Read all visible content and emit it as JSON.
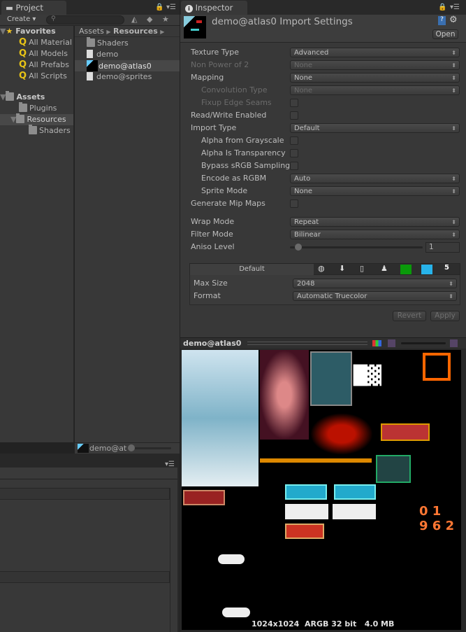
{
  "project": {
    "tab": "Project",
    "create": "Create",
    "search_placeholder": "",
    "favorites": {
      "title": "Favorites",
      "items": [
        "All Material",
        "All Models",
        "All Prefabs",
        "All Scripts"
      ]
    },
    "assets": {
      "title": "Assets",
      "items": [
        "Plugins",
        "Resources",
        "Shaders"
      ]
    },
    "breadcrumb": [
      "Assets",
      "Resources"
    ],
    "files": [
      "Shaders",
      "demo",
      "demo@atlas0",
      "demo@sprites"
    ],
    "footer_selected": "demo@at",
    "footer_zoom": 0.0
  },
  "inspector": {
    "tab": "Inspector",
    "title": "demo@atlas0 Import Settings",
    "open": "Open",
    "rows": [
      {
        "label": "Texture Type",
        "value": "Advanced"
      },
      {
        "label": "Non Power of 2",
        "value": "None"
      },
      {
        "label": "Mapping",
        "value": "None"
      },
      {
        "label": "Convolution Type",
        "value": "None"
      },
      {
        "label": "Fixup Edge Seams"
      },
      {
        "label": "Read/Write Enabled"
      },
      {
        "label": "Import Type",
        "value": "Default"
      },
      {
        "label": "Alpha from Grayscale"
      },
      {
        "label": "Alpha Is Transparency"
      },
      {
        "label": "Bypass sRGB Sampling"
      },
      {
        "label": "Encode as RGBM",
        "value": "Auto"
      },
      {
        "label": "Sprite Mode",
        "value": "None"
      },
      {
        "label": "Generate Mip Maps"
      },
      {
        "label": "Wrap Mode",
        "value": "Repeat"
      },
      {
        "label": "Filter Mode",
        "value": "Bilinear"
      },
      {
        "label": "Aniso Level",
        "value": "1"
      }
    ],
    "platform_default": "Default",
    "platform_icons": [
      "globe-icon",
      "download-icon",
      "phone-icon",
      "android-icon",
      "windows-store-icon",
      "windows-phone-icon",
      "html5-icon"
    ],
    "max_size": {
      "label": "Max Size",
      "value": "2048"
    },
    "format": {
      "label": "Format",
      "value": "Automatic Truecolor"
    },
    "revert": "Revert",
    "apply": "Apply"
  },
  "preview": {
    "title": "demo@atlas0",
    "info": "1024x1024  ARGB 32 bit   4.0 MB"
  },
  "colors": {
    "panel": "#383838",
    "accent": "#3e5f96"
  }
}
